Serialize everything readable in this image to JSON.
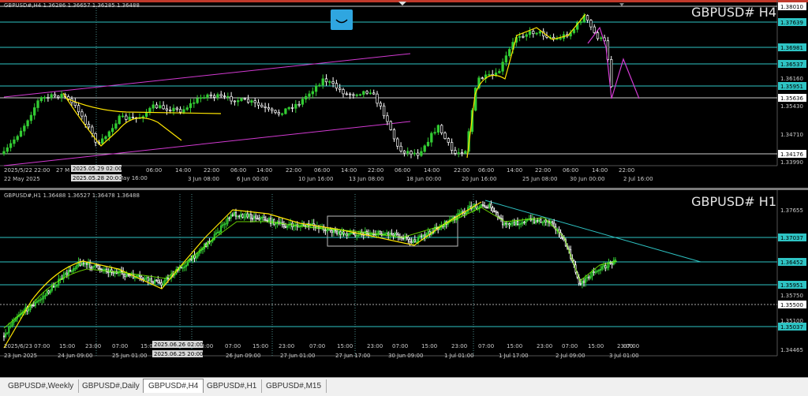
{
  "top": {
    "info": "GBPUSD#,H4  1.36286 1.36657 1.36285 1.36488",
    "title": "GBPUSD# H4",
    "prices": [
      "1.38010",
      "1.37639",
      "1.36981",
      "1.36537",
      "1.36160",
      "1.35951",
      "1.35636",
      "1.35430",
      "1.34710",
      "1.34176",
      "1.33990"
    ],
    "highlighted_prices": [
      "1.38010",
      "1.37639",
      "1.36981",
      "1.36537",
      "1.35951",
      "1.35636",
      "1.34176"
    ],
    "time_labels": [
      "2025/5/22 22:00",
      "27 M",
      "2025.05.29 02:00",
      "2025.05.28 20:00",
      "May 16:00",
      "06:00",
      "14:00",
      "22:00",
      "3 Jun 08:00",
      "06:00",
      "6 Jun 00:00",
      "14:00",
      "22:00",
      "10 Jun 16:00",
      "06:00",
      "13 Jun 08:00",
      "14:00",
      "22:00",
      "18 Jun 00:00",
      "06:00",
      "14:00",
      "22:00",
      "20 Jun 16:00",
      "06:00",
      "14:00",
      "22:00",
      "25 Jun 08:00",
      "06:00",
      "30 Jun 00:00",
      "14:00",
      "22:00",
      "2 Jul 16:00",
      "22 May 2025"
    ]
  },
  "bottom": {
    "info": "GBPUSD#,H1  1.36488 1.36527 1.36478 1.36488",
    "title": "GBPUSD# H1",
    "prices": [
      "1.37655",
      "1.37037",
      "1.36452",
      "1.35951",
      "1.35750",
      "1.35500",
      "1.35100",
      "1.35037",
      "1.34465"
    ],
    "time_labels": [
      "2025/6/23 07:00",
      "15:00",
      "23:00",
      "07:00",
      "15:00",
      "2025.06.26 02:00",
      "2025.06.25 20:00",
      "23:00",
      "07:00",
      "15:00",
      "23:00",
      "07:00",
      "15:00",
      "23:00",
      "07:00",
      "15:00",
      "23:00",
      "07:00",
      "15:00",
      "23:00",
      "07:00",
      "15:00",
      "23:00",
      "07:00",
      "23 Jun 2025",
      "24 Jun 09:00",
      "25 Jun 01:00",
      "26 Jun 09:00",
      "27 Jun 01:00",
      "27 Jun 17:00",
      "30 Jun 09:00",
      "1 Jul 01:00",
      "1 Jul 17:00",
      "2 Jul 09:00",
      "3 Jul 01:00"
    ]
  },
  "tabs": [
    {
      "label": "GBPUSD#,Weekly",
      "active": false
    },
    {
      "label": "GBPUSD#,Daily",
      "active": false
    },
    {
      "label": "GBPUSD#,H4",
      "active": true
    },
    {
      "label": "GBPUSD#,H1",
      "active": false
    },
    {
      "label": "GBPUSD#,M15",
      "active": false
    }
  ],
  "colors": {
    "background": "#000000",
    "bull": "#33cc33",
    "bear": "#ffffff",
    "hline": "#2ec4c4",
    "ma_yellow": "#ffe600",
    "trend_magenta": "#d23ad2",
    "ma_green": "#7fff00"
  }
}
